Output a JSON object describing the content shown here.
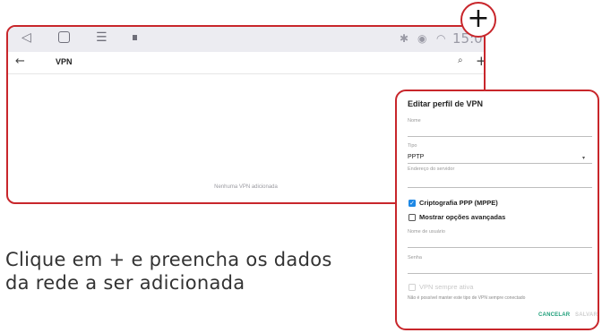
{
  "nav": {
    "back_icon": "triangle-back-icon",
    "home_icon": "square-home-icon",
    "menu_icon": "hamburger-menu-icon",
    "status_time": "15:0"
  },
  "appbar": {
    "title": "VPN",
    "back_glyph": "←",
    "search_glyph": "⌕",
    "add_glyph": "+"
  },
  "main": {
    "empty_message": "Nenhuma VPN adicionada"
  },
  "highlight": {
    "plus_glyph": "+"
  },
  "instruction": "Clique em + e preencha os dados\nda rede a ser adicionada",
  "dialog": {
    "title": "Editar perfil de VPN",
    "name_label": "Nome",
    "type_label": "Tipo",
    "type_value": "PPTP",
    "server_label": "Endereço do servidor",
    "ppp_encryption_label": "Criptografia PPP (MPPE)",
    "ppp_encryption_checked": true,
    "advanced_label": "Mostrar opções avançadas",
    "advanced_checked": false,
    "username_label": "Nome de usuário",
    "password_label": "Senha",
    "always_on_label": "VPN sempre ativa",
    "always_on_note": "Não é possível manter este tipo de VPN sempre conectado",
    "cancel_label": "CANCELAR",
    "save_label": "SALVAR"
  },
  "colors": {
    "highlight_red": "#c8262b",
    "checkbox_blue": "#1e88e5",
    "button_green": "#1e9f7a"
  }
}
